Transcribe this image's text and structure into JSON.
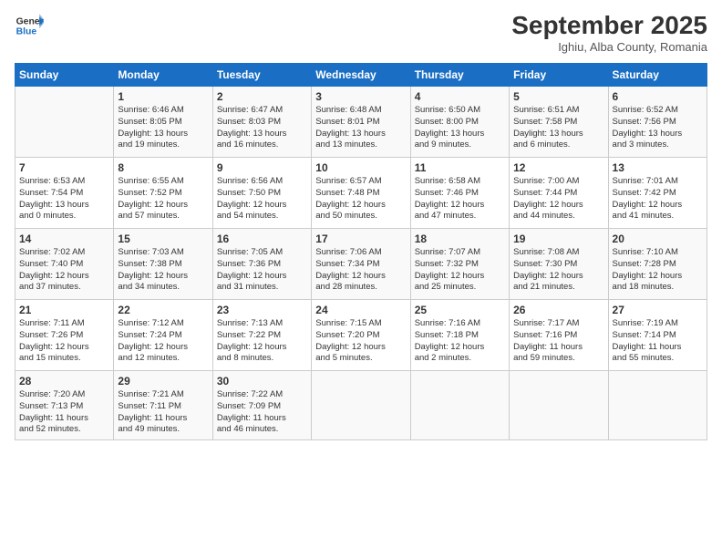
{
  "logo": {
    "line1": "General",
    "line2": "Blue",
    "arrow_color": "#1a6fc4"
  },
  "title": "September 2025",
  "location": "Ighiu, Alba County, Romania",
  "days_of_week": [
    "Sunday",
    "Monday",
    "Tuesday",
    "Wednesday",
    "Thursday",
    "Friday",
    "Saturday"
  ],
  "weeks": [
    [
      {
        "day": "",
        "info": ""
      },
      {
        "day": "1",
        "info": "Sunrise: 6:46 AM\nSunset: 8:05 PM\nDaylight: 13 hours\nand 19 minutes."
      },
      {
        "day": "2",
        "info": "Sunrise: 6:47 AM\nSunset: 8:03 PM\nDaylight: 13 hours\nand 16 minutes."
      },
      {
        "day": "3",
        "info": "Sunrise: 6:48 AM\nSunset: 8:01 PM\nDaylight: 13 hours\nand 13 minutes."
      },
      {
        "day": "4",
        "info": "Sunrise: 6:50 AM\nSunset: 8:00 PM\nDaylight: 13 hours\nand 9 minutes."
      },
      {
        "day": "5",
        "info": "Sunrise: 6:51 AM\nSunset: 7:58 PM\nDaylight: 13 hours\nand 6 minutes."
      },
      {
        "day": "6",
        "info": "Sunrise: 6:52 AM\nSunset: 7:56 PM\nDaylight: 13 hours\nand 3 minutes."
      }
    ],
    [
      {
        "day": "7",
        "info": "Sunrise: 6:53 AM\nSunset: 7:54 PM\nDaylight: 13 hours\nand 0 minutes."
      },
      {
        "day": "8",
        "info": "Sunrise: 6:55 AM\nSunset: 7:52 PM\nDaylight: 12 hours\nand 57 minutes."
      },
      {
        "day": "9",
        "info": "Sunrise: 6:56 AM\nSunset: 7:50 PM\nDaylight: 12 hours\nand 54 minutes."
      },
      {
        "day": "10",
        "info": "Sunrise: 6:57 AM\nSunset: 7:48 PM\nDaylight: 12 hours\nand 50 minutes."
      },
      {
        "day": "11",
        "info": "Sunrise: 6:58 AM\nSunset: 7:46 PM\nDaylight: 12 hours\nand 47 minutes."
      },
      {
        "day": "12",
        "info": "Sunrise: 7:00 AM\nSunset: 7:44 PM\nDaylight: 12 hours\nand 44 minutes."
      },
      {
        "day": "13",
        "info": "Sunrise: 7:01 AM\nSunset: 7:42 PM\nDaylight: 12 hours\nand 41 minutes."
      }
    ],
    [
      {
        "day": "14",
        "info": "Sunrise: 7:02 AM\nSunset: 7:40 PM\nDaylight: 12 hours\nand 37 minutes."
      },
      {
        "day": "15",
        "info": "Sunrise: 7:03 AM\nSunset: 7:38 PM\nDaylight: 12 hours\nand 34 minutes."
      },
      {
        "day": "16",
        "info": "Sunrise: 7:05 AM\nSunset: 7:36 PM\nDaylight: 12 hours\nand 31 minutes."
      },
      {
        "day": "17",
        "info": "Sunrise: 7:06 AM\nSunset: 7:34 PM\nDaylight: 12 hours\nand 28 minutes."
      },
      {
        "day": "18",
        "info": "Sunrise: 7:07 AM\nSunset: 7:32 PM\nDaylight: 12 hours\nand 25 minutes."
      },
      {
        "day": "19",
        "info": "Sunrise: 7:08 AM\nSunset: 7:30 PM\nDaylight: 12 hours\nand 21 minutes."
      },
      {
        "day": "20",
        "info": "Sunrise: 7:10 AM\nSunset: 7:28 PM\nDaylight: 12 hours\nand 18 minutes."
      }
    ],
    [
      {
        "day": "21",
        "info": "Sunrise: 7:11 AM\nSunset: 7:26 PM\nDaylight: 12 hours\nand 15 minutes."
      },
      {
        "day": "22",
        "info": "Sunrise: 7:12 AM\nSunset: 7:24 PM\nDaylight: 12 hours\nand 12 minutes."
      },
      {
        "day": "23",
        "info": "Sunrise: 7:13 AM\nSunset: 7:22 PM\nDaylight: 12 hours\nand 8 minutes."
      },
      {
        "day": "24",
        "info": "Sunrise: 7:15 AM\nSunset: 7:20 PM\nDaylight: 12 hours\nand 5 minutes."
      },
      {
        "day": "25",
        "info": "Sunrise: 7:16 AM\nSunset: 7:18 PM\nDaylight: 12 hours\nand 2 minutes."
      },
      {
        "day": "26",
        "info": "Sunrise: 7:17 AM\nSunset: 7:16 PM\nDaylight: 11 hours\nand 59 minutes."
      },
      {
        "day": "27",
        "info": "Sunrise: 7:19 AM\nSunset: 7:14 PM\nDaylight: 11 hours\nand 55 minutes."
      }
    ],
    [
      {
        "day": "28",
        "info": "Sunrise: 7:20 AM\nSunset: 7:13 PM\nDaylight: 11 hours\nand 52 minutes."
      },
      {
        "day": "29",
        "info": "Sunrise: 7:21 AM\nSunset: 7:11 PM\nDaylight: 11 hours\nand 49 minutes."
      },
      {
        "day": "30",
        "info": "Sunrise: 7:22 AM\nSunset: 7:09 PM\nDaylight: 11 hours\nand 46 minutes."
      },
      {
        "day": "",
        "info": ""
      },
      {
        "day": "",
        "info": ""
      },
      {
        "day": "",
        "info": ""
      },
      {
        "day": "",
        "info": ""
      }
    ]
  ]
}
